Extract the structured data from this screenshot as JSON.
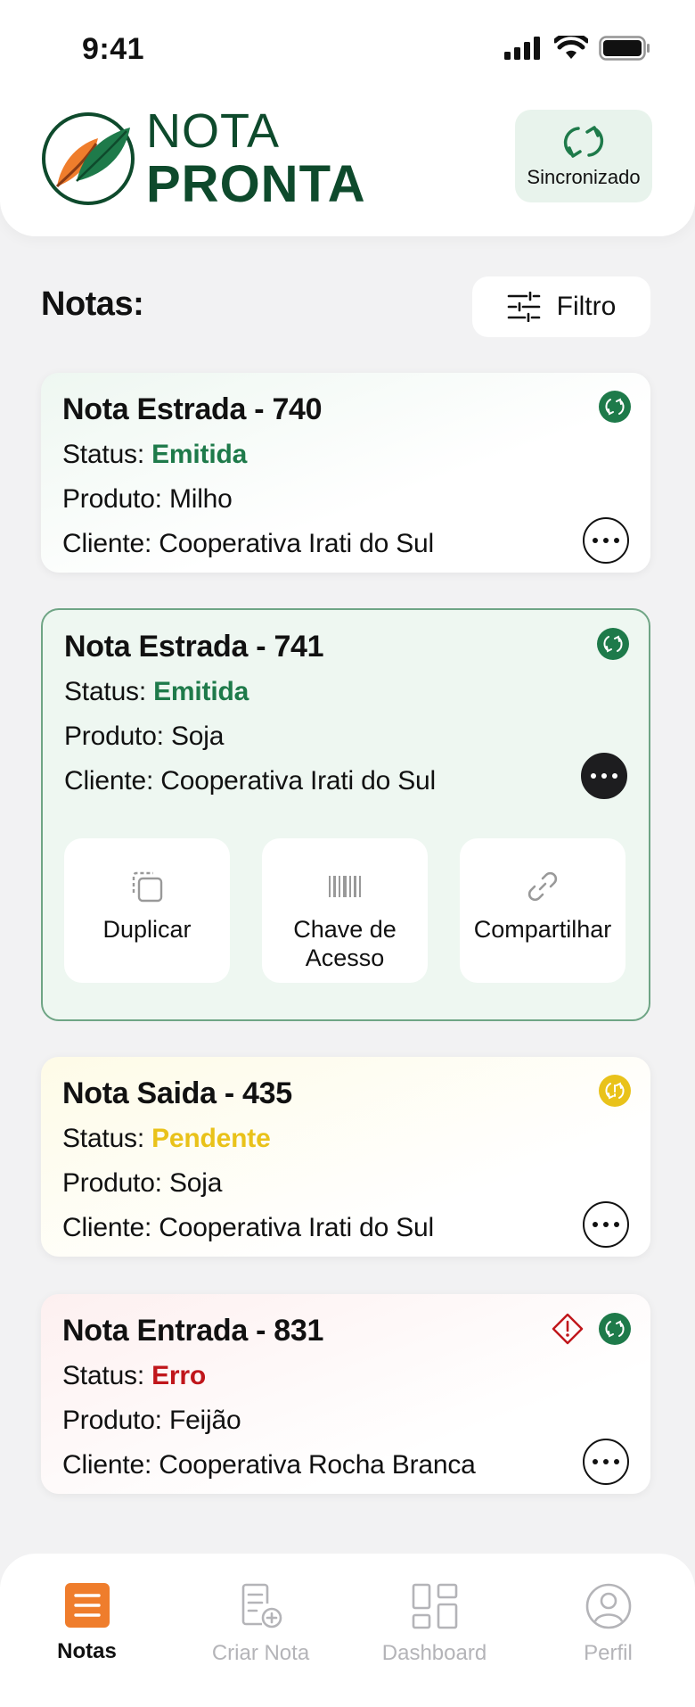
{
  "status_bar": {
    "time": "9:41"
  },
  "brand": {
    "line1": "NOTA",
    "line2": "PRONTA",
    "primary_color": "#0e4a2c",
    "accent_color": "#ef7d2c"
  },
  "sync": {
    "label": "Sincronizado",
    "icon": "sync-icon"
  },
  "page": {
    "title": "Notas:",
    "filter_label": "Filtro"
  },
  "notes": [
    {
      "title": "Nota Estrada - 740",
      "status_prefix": "Status: ",
      "status": "Emitida",
      "status_color": "#1e7a4a",
      "produto": "Produto: Milho",
      "cliente": "Cliente: Cooperativa Irati do Sul",
      "sync_state": "synced",
      "expanded": false
    },
    {
      "title": "Nota Estrada - 741",
      "status_prefix": "Status: ",
      "status": "Emitida",
      "status_color": "#1e7a4a",
      "produto": "Produto: Soja",
      "cliente": "Cliente: Cooperativa Irati do Sul",
      "sync_state": "synced",
      "expanded": true
    },
    {
      "title": "Nota Saida - 435",
      "status_prefix": "Status: ",
      "status": "Pendente",
      "status_color": "#e9c21a",
      "produto": "Produto: Soja",
      "cliente": "Cliente: Cooperativa Irati do Sul",
      "sync_state": "pending",
      "expanded": false
    },
    {
      "title": "Nota Entrada - 831",
      "status_prefix": "Status: ",
      "status": "Erro",
      "status_color": "#c0161b",
      "produto": "Produto: Feijão",
      "cliente": "Cliente: Cooperativa Rocha Branca",
      "sync_state": "synced",
      "warning": true,
      "expanded": false
    }
  ],
  "actions": {
    "duplicate": "Duplicar",
    "access_key_1": "Chave de",
    "access_key_2": "Acesso",
    "share": "Compartilhar"
  },
  "nav": [
    {
      "label": "Notas",
      "icon": "notes-icon",
      "active": true
    },
    {
      "label": "Criar Nota",
      "icon": "create-note-icon",
      "active": false
    },
    {
      "label": "Dashboard",
      "icon": "dashboard-icon",
      "active": false
    },
    {
      "label": "Perfil",
      "icon": "profile-icon",
      "active": false
    }
  ]
}
